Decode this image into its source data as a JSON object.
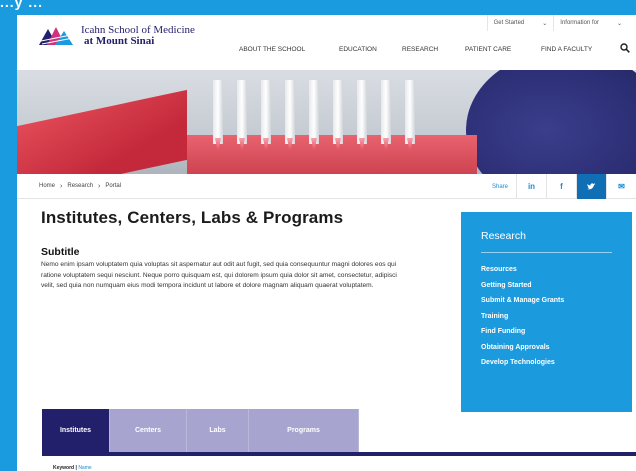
{
  "top_strip": {
    "partial_text": "...y ..."
  },
  "header": {
    "utility": [
      {
        "label": "Get Started"
      },
      {
        "label": "Information for"
      }
    ],
    "logo": {
      "line1": "Icahn School of Medicine",
      "line2": "at Mount Sinai"
    },
    "nav": [
      "ABOUT THE SCHOOL",
      "EDUCATION",
      "RESEARCH",
      "PATIENT CARE",
      "FIND A FACULTY"
    ],
    "search_icon": "search-icon"
  },
  "breadcrumb": [
    "Home",
    "Research",
    "Portal"
  ],
  "share": {
    "label": "Share",
    "buttons": [
      {
        "icon": "linkedin-icon",
        "glyph": "in"
      },
      {
        "icon": "facebook-icon",
        "glyph": "f"
      },
      {
        "icon": "twitter-icon",
        "glyph": "t"
      },
      {
        "icon": "email-icon",
        "glyph": "✉"
      }
    ]
  },
  "main": {
    "title": "Institutes, Centers, Labs & Programs",
    "subtitle": "Subtitle",
    "body": "Nemo enim ipsam voluptatem quia voluptas sit aspernatur aut odit aut fugit, sed quia consequuntur magni dolores eos qui ratione voluptatem sequi nesciunt. Neque porro quisquam est, qui dolorem ipsum quia dolor sit amet, consectetur, adipisci velit, sed quia non numquam eius modi tempora incidunt ut labore et dolore magnam aliquam quaerat voluptatem."
  },
  "sidebar": {
    "heading": "Research",
    "items": [
      "Resources",
      "Getting Started",
      "Submit & Manage Grants",
      "Training",
      "Find Funding",
      "Obtaining Approvals",
      "Develop Technologies"
    ]
  },
  "tabs": [
    "Institutes",
    "Centers",
    "Labs",
    "Programs"
  ],
  "filter": {
    "keyword": "Keyword",
    "sep": " | ",
    "name": "Name"
  },
  "colors": {
    "frame_blue": "#1a9be0",
    "brand_navy": "#221f6b",
    "sidebar_blue": "#1c9ade",
    "tab_inactive": "#a7a5cf",
    "link_blue": "#1a8cd8"
  }
}
